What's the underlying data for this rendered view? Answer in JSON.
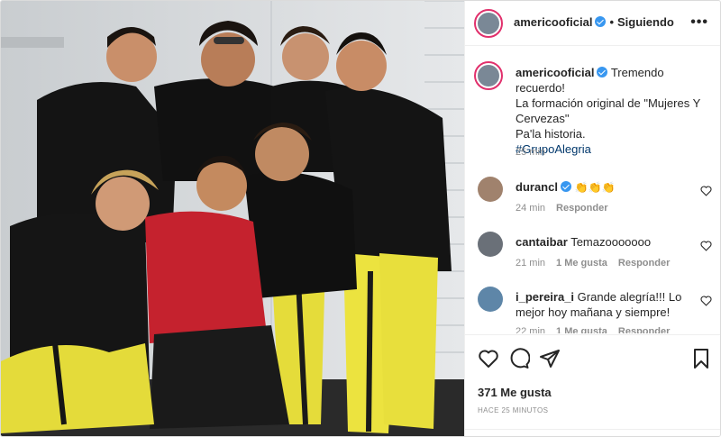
{
  "header": {
    "username": "americooficial",
    "follow_status": "Siguiendo",
    "more_label": "•••"
  },
  "caption": {
    "username": "americooficial",
    "text_line1": "Tremendo recuerdo!",
    "text_line2": "La formación original de \"Mujeres Y",
    "text_line3": "Cervezas\"",
    "text_line4": "Pa'la historia.",
    "hashtag": "#GrupoAlegria",
    "time": "25 min"
  },
  "comments": [
    {
      "username": "durancl",
      "verified": true,
      "text": "👏👏👏",
      "time": "24 min",
      "likes": "",
      "reply": "Responder"
    },
    {
      "username": "cantaibar",
      "verified": false,
      "text": "Temazooooooo",
      "time": "21 min",
      "likes": "1 Me gusta",
      "reply": "Responder"
    },
    {
      "username": "i_pereira_i",
      "verified": false,
      "text": "Grande alegría!!! Lo mejor hoy mañana y siempre!",
      "time": "22 min",
      "likes": "1 Me gusta",
      "reply": "Responder"
    }
  ],
  "actions": {
    "likes": "371 Me gusta",
    "ago": "HACE 25 MINUTOS"
  },
  "colors": {
    "verified": "#3897f0",
    "story_ring": "#e1306c",
    "hashtag": "#00376b",
    "muted": "#8e8e8e"
  },
  "icons": [
    "more-options-icon",
    "heart-icon",
    "comment-icon",
    "share-icon",
    "bookmark-icon",
    "emoji-icon"
  ]
}
